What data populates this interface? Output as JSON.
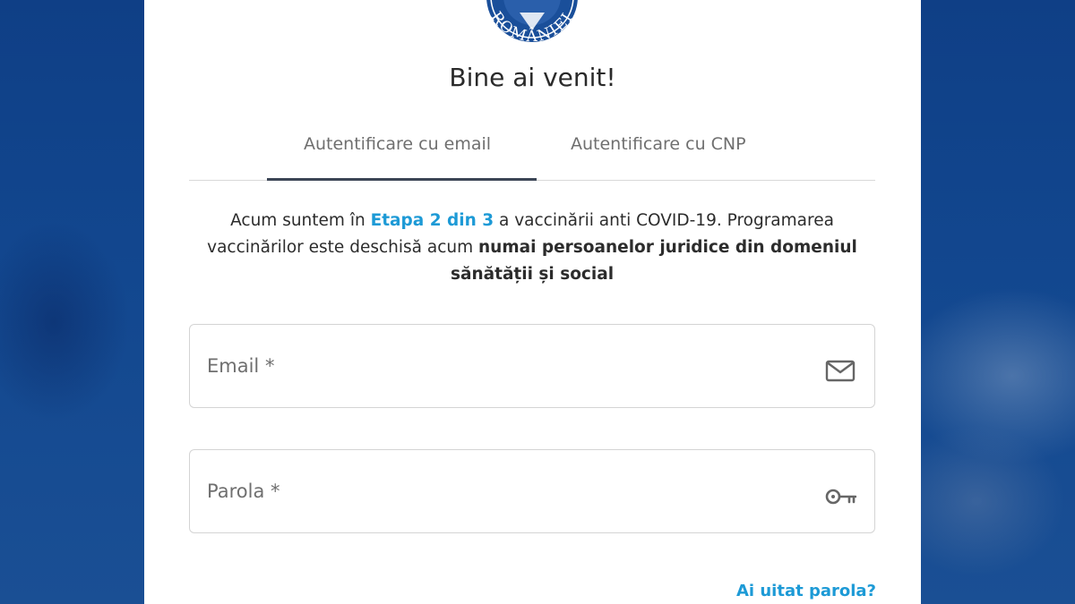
{
  "logo": {
    "text": "ROMÂNIEI"
  },
  "title": "Bine ai venit!",
  "tabs": [
    {
      "label": "Autentificare cu email",
      "active": true
    },
    {
      "label": "Autentificare cu CNP",
      "active": false
    }
  ],
  "notice": {
    "part1": "Acum suntem în ",
    "highlight": "Etapa 2 din 3",
    "part2": " a vaccinării anti COVID-19. Programarea vaccinărilor este deschisă acum ",
    "bold": "numai persoanelor juridice din domeniul sănătății și social"
  },
  "form": {
    "email_label": "Email *",
    "email_icon": "envelope-icon",
    "password_label": "Parola *",
    "password_icon": "key-icon",
    "forgot_label": "Ai uitat parola?"
  },
  "colors": {
    "accent": "#1d9ad6",
    "background": "#12478f",
    "tab_indicator": "#3c4656"
  }
}
